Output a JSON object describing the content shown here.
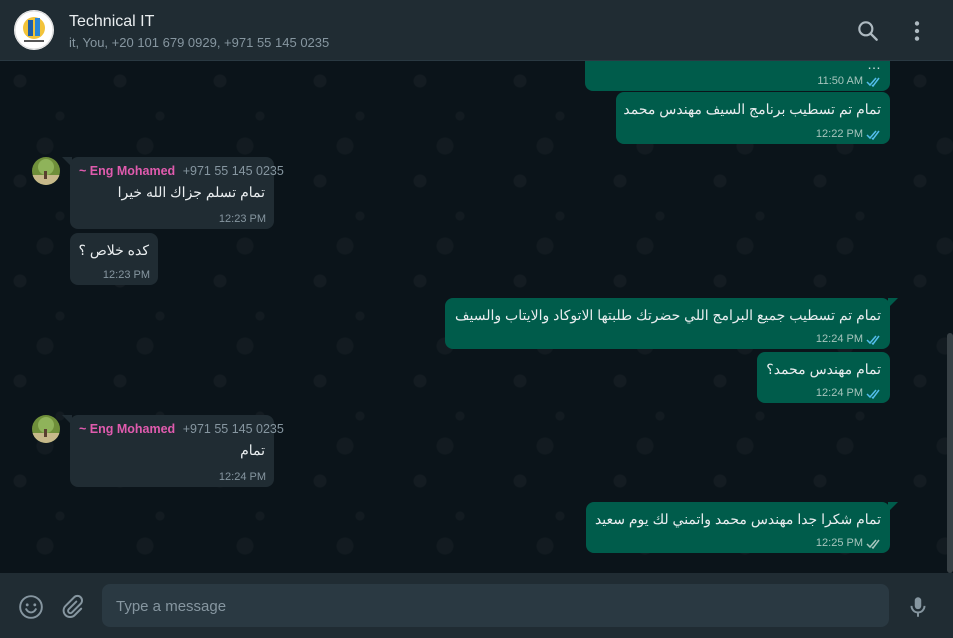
{
  "header": {
    "title": "Technical IT",
    "subtitle": "it, You, +20 101 679 0929, +971 55 145 0235",
    "avatar_icon": "group-logo",
    "search_icon": "search-icon",
    "menu_icon": "kebab-menu-icon"
  },
  "messages": [
    {
      "direction": "out",
      "text": "…",
      "time": "11:50 AM",
      "status": "read"
    },
    {
      "direction": "out",
      "text": "تمام تم تسطيب برنامج السيف مهندس محمد",
      "time": "12:22 PM",
      "status": "read"
    },
    {
      "direction": "in",
      "sender": "~ Eng Mohamed",
      "phone": "+971 55 145 0235",
      "text": "تمام تسلم جزاك الله خيرا",
      "time": "12:23 PM"
    },
    {
      "direction": "in",
      "text": "كده خلاص ؟",
      "time": "12:23 PM"
    },
    {
      "direction": "out",
      "text": "تمام تم تسطيب جميع البرامج اللي حضرتك طلبتها الاتوكاد والايتاب والسيف",
      "time": "12:24 PM",
      "status": "read"
    },
    {
      "direction": "out",
      "text": "تمام مهندس محمد؟",
      "time": "12:24 PM",
      "status": "read"
    },
    {
      "direction": "in",
      "sender": "~ Eng Mohamed",
      "phone": "+971 55 145 0235",
      "text": "تمام",
      "time": "12:24 PM"
    },
    {
      "direction": "out",
      "text": "تمام شكرا جدا مهندس محمد واتمني لك يوم سعيد",
      "time": "12:25 PM",
      "status": "delivered"
    }
  ],
  "composer": {
    "placeholder": "Type a message",
    "emoji_icon": "emoji-icon",
    "attach_icon": "paperclip-icon",
    "mic_icon": "microphone-icon"
  },
  "colors": {
    "outgoing_bubble": "#005c4b",
    "incoming_bubble": "#202c33",
    "sender_name": "#e05bae",
    "read_ticks": "#53bdeb"
  }
}
